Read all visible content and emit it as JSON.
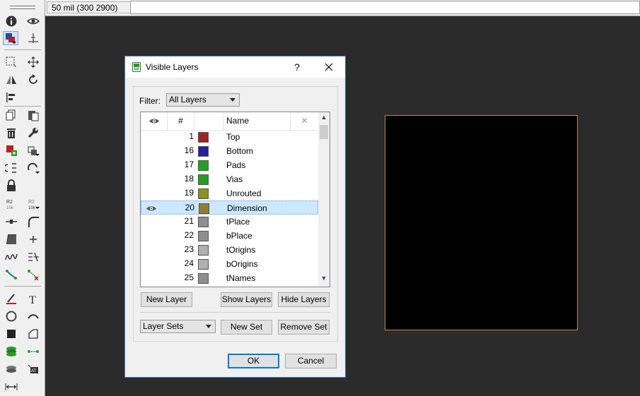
{
  "statusbar": {
    "coordinates": "50 mil (300 2900)",
    "command": ""
  },
  "toolbar": {
    "tools": [
      "info-icon",
      "eye-icon",
      "layer-color-icon",
      "mark-icon",
      "group-icon",
      "move-icon",
      "mirror-icon",
      "rotate-icon",
      "align-icon",
      "copy-icon",
      "paste-icon",
      "delete-icon",
      "wrench-icon",
      "add-part-icon",
      "replace-icon",
      "swap-icon",
      "optimize-icon",
      "lock-icon",
      "name-icon",
      "value-icon",
      "split-icon",
      "miter-icon",
      "bend-icon",
      "add-icon",
      "meander-icon",
      "ripup-icon",
      "route-icon",
      "unroute-icon",
      "line-icon",
      "text-icon",
      "circle-icon",
      "arc-icon",
      "rect-icon",
      "polygon-icon",
      "via-icon",
      "signal-icon",
      "hole-icon",
      "attribute-icon",
      "dimension-icon"
    ],
    "value_label": "R2\n10k",
    "name_label": "R2"
  },
  "dialog": {
    "title": "Visible Layers",
    "help_label": "?",
    "close_label": "✕",
    "filter_label": "Filter:",
    "filter_value": "All Layers",
    "columns": {
      "num": "#",
      "name": "Name",
      "delete": "✕"
    },
    "layers": [
      {
        "num": "1",
        "name": "Top",
        "color": "#9e2222",
        "visible": false,
        "selected": false
      },
      {
        "num": "16",
        "name": "Bottom",
        "color": "#22229e",
        "visible": false,
        "selected": false
      },
      {
        "num": "17",
        "name": "Pads",
        "color": "#229e22",
        "visible": false,
        "selected": false
      },
      {
        "num": "18",
        "name": "Vias",
        "color": "#229e22",
        "visible": false,
        "selected": false
      },
      {
        "num": "19",
        "name": "Unrouted",
        "color": "#8f8f22",
        "visible": false,
        "selected": false
      },
      {
        "num": "20",
        "name": "Dimension",
        "color": "#8f7f33",
        "visible": true,
        "selected": true
      },
      {
        "num": "21",
        "name": "tPlace",
        "color": "#8e8e8e",
        "visible": false,
        "selected": false
      },
      {
        "num": "22",
        "name": "bPlace",
        "color": "#8e8e8e",
        "visible": false,
        "selected": false
      },
      {
        "num": "23",
        "name": "tOrigins",
        "color": "#b0b0b0",
        "visible": false,
        "selected": false
      },
      {
        "num": "24",
        "name": "bOrigins",
        "color": "#b0b0b0",
        "visible": false,
        "selected": false
      },
      {
        "num": "25",
        "name": "tNames",
        "color": "#8e8e8e",
        "visible": false,
        "selected": false
      }
    ],
    "new_layer_label": "New Layer",
    "show_layers_label": "Show Layers",
    "hide_layers_label": "Hide Layers",
    "layer_sets_value": "Layer Sets",
    "new_set_label": "New Set",
    "remove_set_label": "Remove Set",
    "ok_label": "OK",
    "cancel_label": "Cancel"
  },
  "colors": {
    "canvas": "#2b2b2b",
    "drawing_frame": "#c08a3a",
    "selection": "#cce8ff",
    "accent": "#0078d7"
  }
}
